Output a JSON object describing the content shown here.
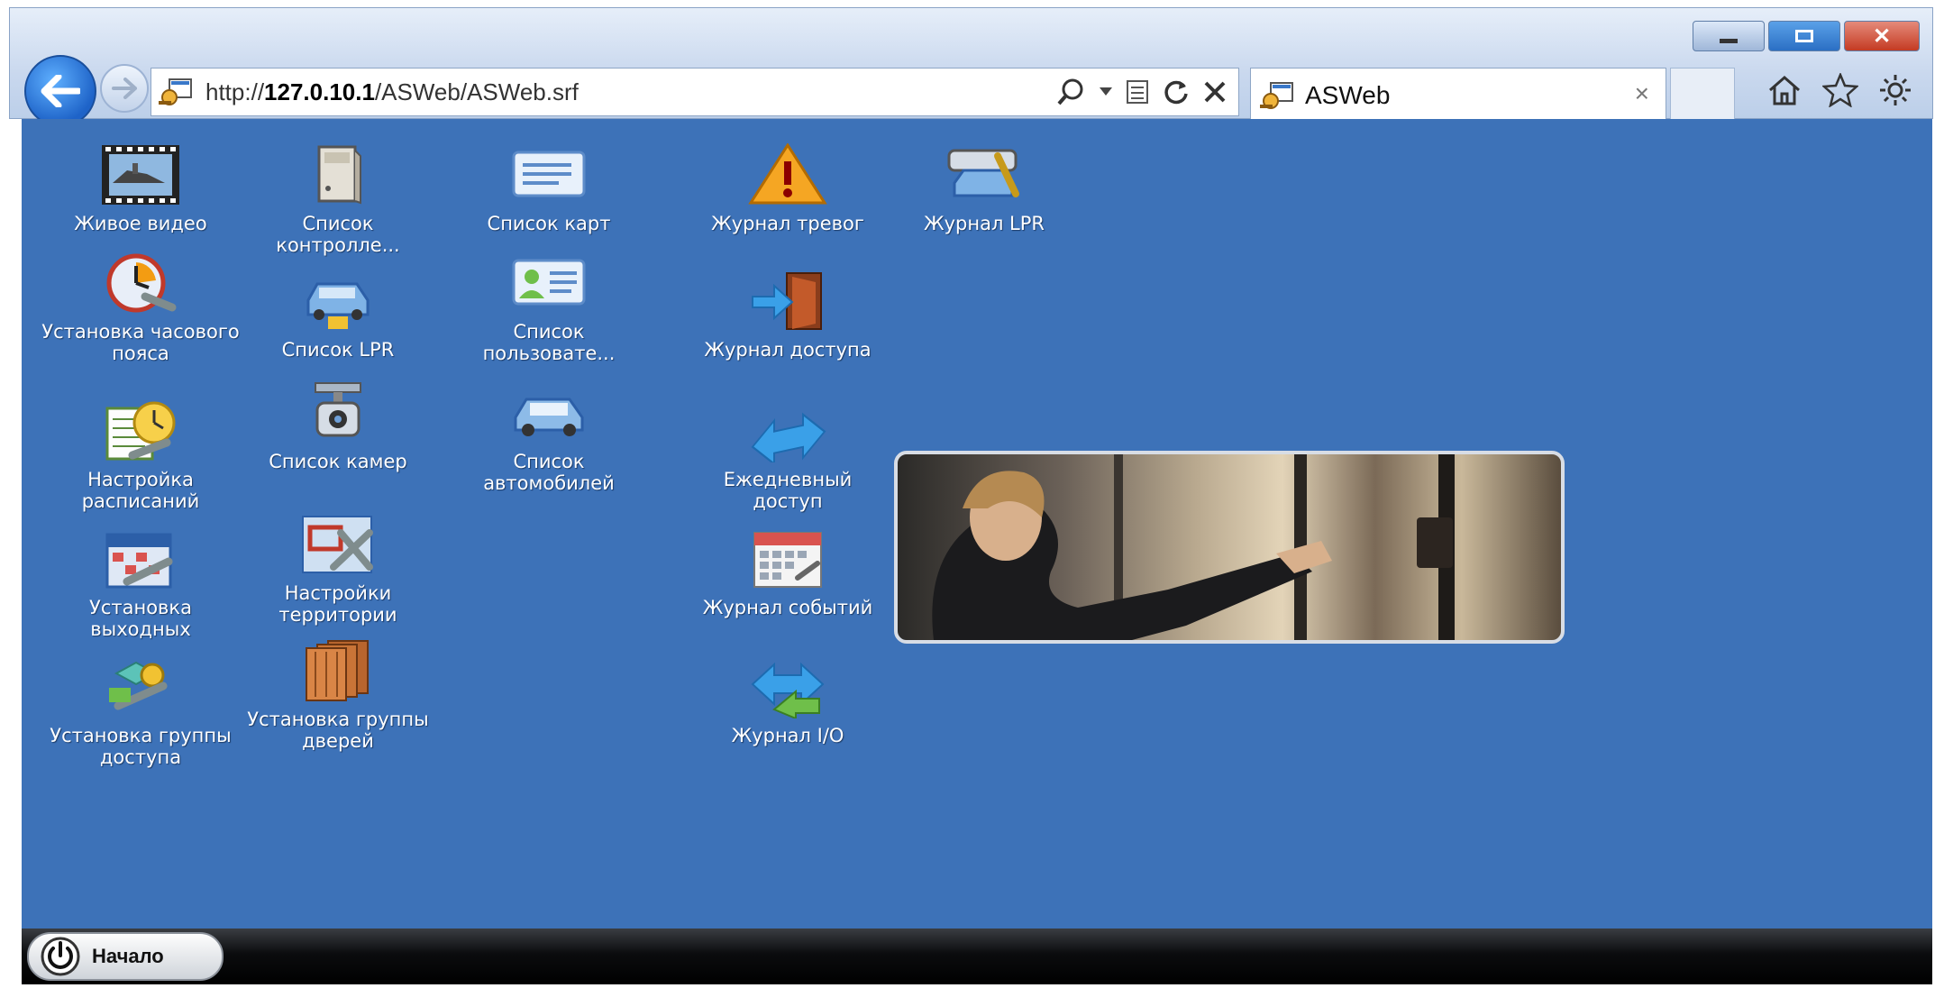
{
  "browser": {
    "url_prefix": "http://",
    "url_host": "127.0.10.1",
    "url_path": "/ASWeb/ASWeb.srf",
    "tab_title": "ASWeb",
    "tab_close": "×"
  },
  "window_buttons": {
    "close": "✕"
  },
  "desktop": {
    "icons": [
      {
        "id": "live-video",
        "label": "Живое видео",
        "icon": "film-ship-icon"
      },
      {
        "id": "controllers",
        "label": "Список контролле...",
        "icon": "controller-device-icon"
      },
      {
        "id": "cards",
        "label": "Список карт",
        "icon": "card-icon"
      },
      {
        "id": "alarm-log",
        "label": "Журнал тревог",
        "icon": "warning-icon"
      },
      {
        "id": "lpr-log",
        "label": "Журнал LPR",
        "icon": "lpr-camera-icon"
      },
      {
        "id": "timezone",
        "label": "Установка часового пояса",
        "icon": "clock-wrench-icon"
      },
      {
        "id": "lpr-list",
        "label": "Список LPR",
        "icon": "car-icon"
      },
      {
        "id": "users",
        "label": "Список пользовате...",
        "icon": "user-card-icon"
      },
      {
        "id": "access-log",
        "label": "Журнал доступа",
        "icon": "door-arrow-icon"
      },
      {
        "id": "schedule",
        "label": "Настройка расписаний",
        "icon": "schedule-wrench-icon"
      },
      {
        "id": "cameras",
        "label": "Список камер",
        "icon": "camera-icon"
      },
      {
        "id": "vehicles",
        "label": "Список автомобилей",
        "icon": "car-icon"
      },
      {
        "id": "daily-access",
        "label": "Ежедневный доступ",
        "icon": "double-arrow-icon"
      },
      {
        "id": "holidays",
        "label": "Установка выходных",
        "icon": "calendar-wrench-icon"
      },
      {
        "id": "territory",
        "label": "Настройки территории",
        "icon": "map-tools-icon"
      },
      {
        "id": "event-log",
        "label": "Журнал событий",
        "icon": "calendar-icon"
      },
      {
        "id": "access-group",
        "label": "Установка группы доступа",
        "icon": "keys-icon"
      },
      {
        "id": "door-group",
        "label": "Установка группы дверей",
        "icon": "doors-icon"
      },
      {
        "id": "io-log",
        "label": "Журнал I/O",
        "icon": "io-arrows-icon"
      }
    ]
  },
  "taskbar": {
    "start_label": "Начало"
  }
}
